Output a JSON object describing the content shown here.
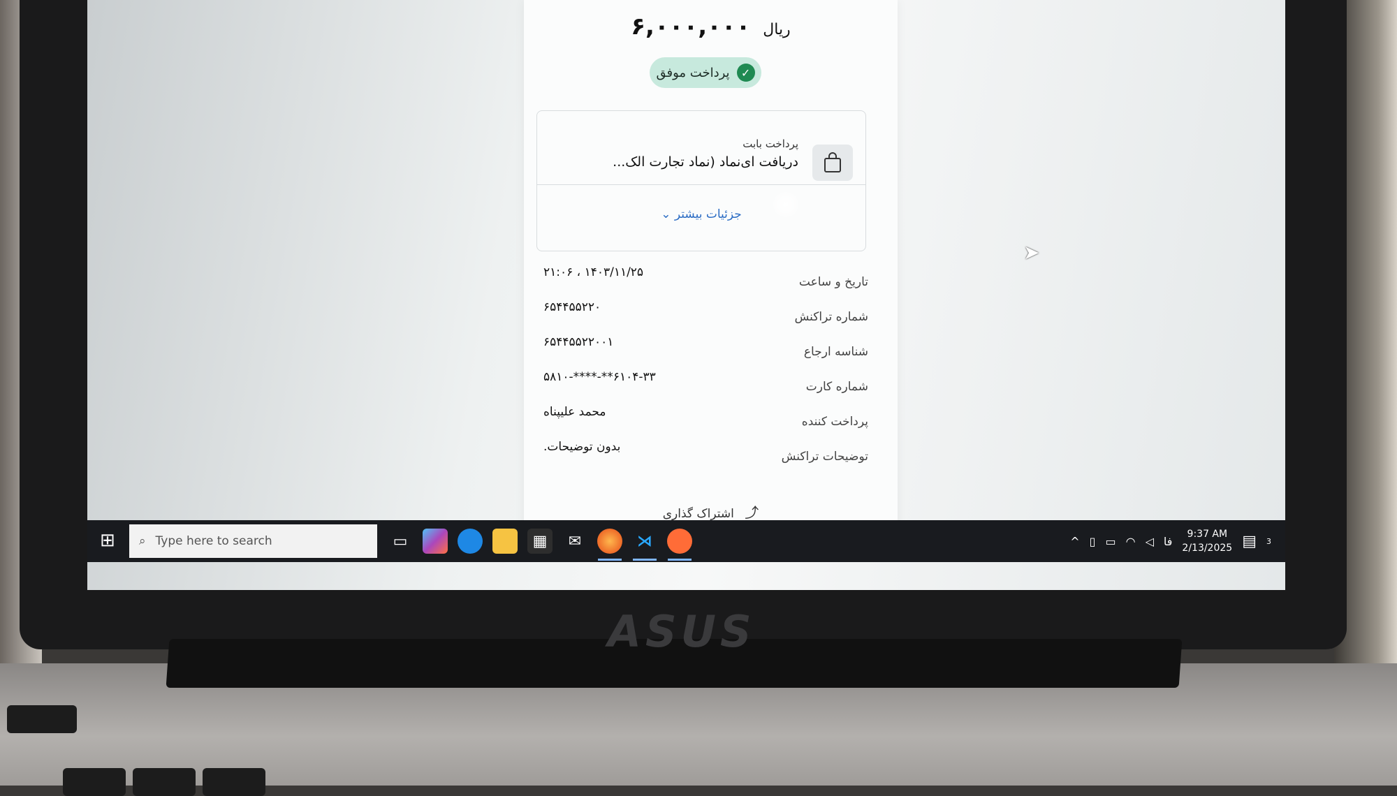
{
  "receipt": {
    "amount": "۶,۰۰۰,۰۰۰",
    "currency": "ریال",
    "status": "پرداخت موفق",
    "item_sub": "پرداخت بابت",
    "item_title": "دریافت ای‌نماد (نماد تجارت الک...",
    "more_details": "جزئیات بیشتر",
    "rows": [
      {
        "label": "تاریخ و ساعت",
        "value": "۱۴۰۳/۱۱/۲۵ ، ۲۱:۰۶"
      },
      {
        "label": "شماره تراکنش",
        "value": "۶۵۴۴۵۵۲۲۰"
      },
      {
        "label": "شناسه ارجاع",
        "value": "۶۵۴۴۵۵۲۲۰۰۱"
      },
      {
        "label": "شماره کارت",
        "value": "۶۱۰۴-۳۳**-****-۵۸۱۰"
      },
      {
        "label": "پرداخت کننده",
        "value": "محمد علیپناه"
      },
      {
        "label": "توضیحات تراکنش",
        "value": "بدون توضیحات."
      }
    ],
    "share": "اشتراک گذاری"
  },
  "taskbar": {
    "search_placeholder": "Type here to search",
    "lang": "فا",
    "time": "9:37 AM",
    "date": "2/13/2025",
    "notification_count": "3",
    "apps": [
      "task-view",
      "copilot",
      "edge",
      "file-explorer",
      "store",
      "mail",
      "firefox",
      "vscode",
      "postman"
    ]
  },
  "brand": "ASUS",
  "colors": {
    "success_badge": "#c7e9dd",
    "success_check": "#1f8a52",
    "link": "#2b6cc4",
    "taskbar": "#191b1f"
  }
}
